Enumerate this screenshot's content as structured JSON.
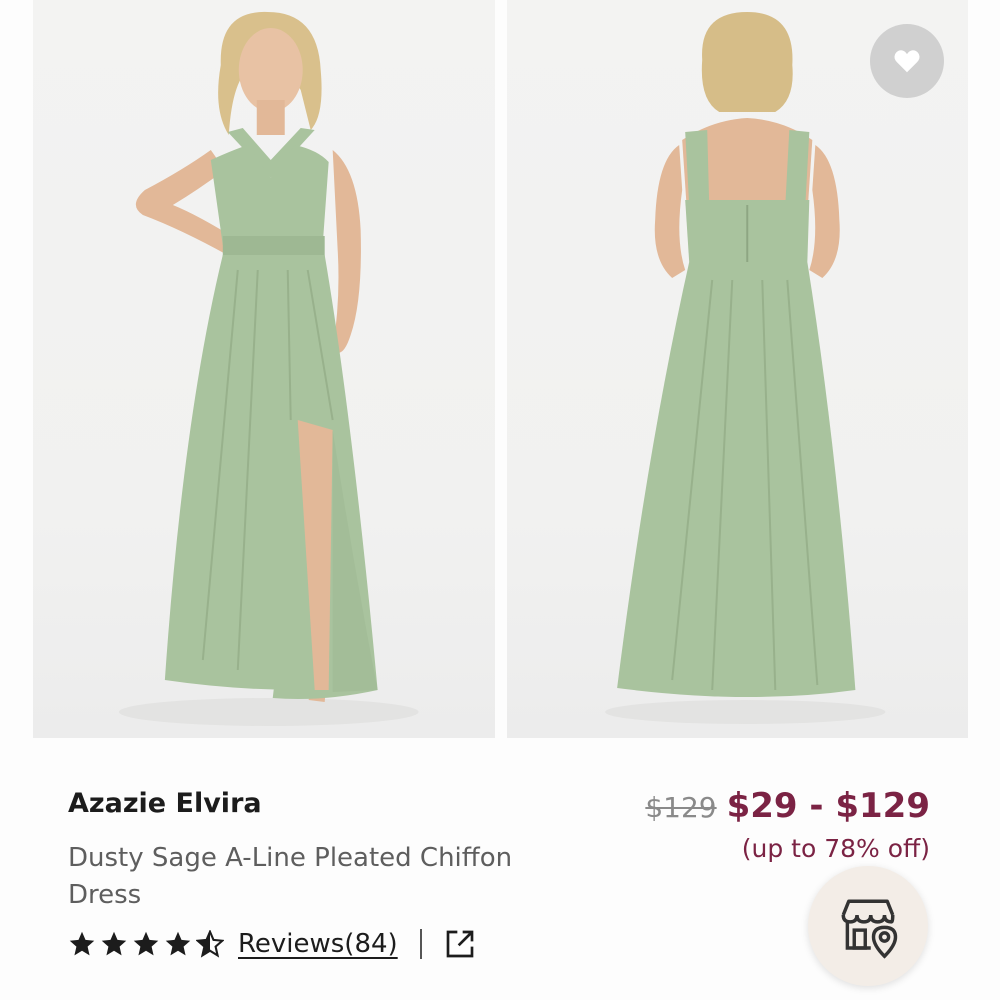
{
  "product": {
    "brand_name": "Azazie Elvira",
    "description": "Dusty Sage A-Line Pleated Chiffon Dress",
    "original_price": "$129",
    "price_range": "$29 - $129",
    "discount": "(up to 78% off)",
    "rating": 4.5,
    "reviews_label": "Reviews(84)"
  },
  "images": [
    {
      "alt": "front",
      "dress_color": "#a9c39e"
    },
    {
      "alt": "back",
      "dress_color": "#a9c39e"
    }
  ],
  "colors": {
    "accent": "#7b2344",
    "favorite_bg": "#d0d0d0",
    "store_bg": "#f3ede7"
  },
  "icons": {
    "favorite": "heart-icon",
    "share": "external-link-icon",
    "store": "store-location-icon",
    "star_full": "star-filled-icon",
    "star_half": "star-half-icon"
  }
}
